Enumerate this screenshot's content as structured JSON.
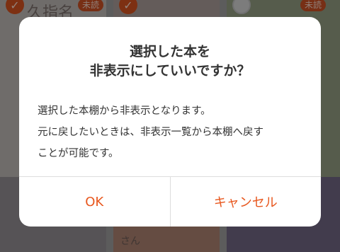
{
  "background": {
    "badges": [
      "未読",
      "未読"
    ],
    "cover_text": [
      "久指名",
      "さん"
    ],
    "check_icons": [
      "checkmark-icon",
      "checkmark-icon",
      "empty-circle-icon"
    ]
  },
  "dialog": {
    "title_lines": [
      "選択した本を",
      "非表示にしていいですか？"
    ],
    "message_lines": [
      "選択した本棚から非表示となります。",
      "元に戻したいときは、非表示一覧から本棚へ戻す",
      "ことが可能です。"
    ],
    "buttons": {
      "ok": "OK",
      "cancel": "キャンセル"
    },
    "accent_color": "#e8581f"
  }
}
